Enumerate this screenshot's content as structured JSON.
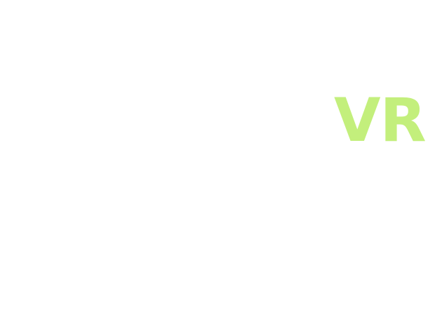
{
  "logo": {
    "text": "VR",
    "color": "#c3ef7c"
  },
  "background_color": "#ffffff"
}
